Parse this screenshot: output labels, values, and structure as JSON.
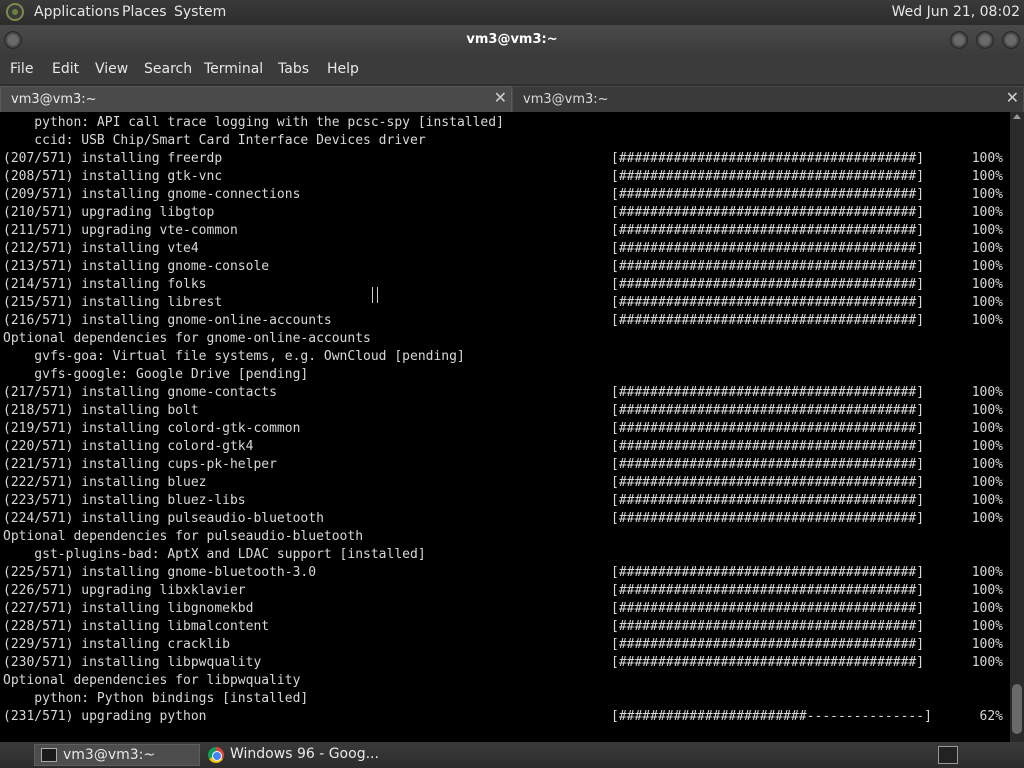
{
  "top_panel": {
    "menus": [
      "Applications",
      "Places",
      "System"
    ],
    "clock": "Wed Jun 21, 08:02"
  },
  "window": {
    "title": "vm3@vm3:~"
  },
  "menubar": [
    "File",
    "Edit",
    "View",
    "Search",
    "Terminal",
    "Tabs",
    "Help"
  ],
  "tabs": [
    {
      "label": "vm3@vm3:~",
      "active": true
    },
    {
      "label": "vm3@vm3:~",
      "active": false
    }
  ],
  "terminal": {
    "lines": [
      {
        "text": "    python: API call trace logging with the pcsc-spy [installed]"
      },
      {
        "text": "    ccid: USB Chip/Smart Card Interface Devices driver"
      },
      {
        "text": "(207/571) installing freerdp",
        "bar": "[######################################]",
        "pct": "100%"
      },
      {
        "text": "(208/571) installing gtk-vnc",
        "bar": "[######################################]",
        "pct": "100%"
      },
      {
        "text": "(209/571) installing gnome-connections",
        "bar": "[######################################]",
        "pct": "100%"
      },
      {
        "text": "(210/571) upgrading libgtop",
        "bar": "[######################################]",
        "pct": "100%"
      },
      {
        "text": "(211/571) upgrading vte-common",
        "bar": "[######################################]",
        "pct": "100%"
      },
      {
        "text": "(212/571) installing vte4",
        "bar": "[######################################]",
        "pct": "100%"
      },
      {
        "text": "(213/571) installing gnome-console",
        "bar": "[######################################]",
        "pct": "100%"
      },
      {
        "text": "(214/571) installing folks",
        "bar": "[######################################]",
        "pct": "100%"
      },
      {
        "text": "(215/571) installing librest",
        "bar": "[######################################]",
        "pct": "100%"
      },
      {
        "text": "(216/571) installing gnome-online-accounts",
        "bar": "[######################################]",
        "pct": "100%"
      },
      {
        "text": "Optional dependencies for gnome-online-accounts"
      },
      {
        "text": "    gvfs-goa: Virtual file systems, e.g. OwnCloud [pending]"
      },
      {
        "text": "    gvfs-google: Google Drive [pending]"
      },
      {
        "text": "(217/571) installing gnome-contacts",
        "bar": "[######################################]",
        "pct": "100%"
      },
      {
        "text": "(218/571) installing bolt",
        "bar": "[######################################]",
        "pct": "100%"
      },
      {
        "text": "(219/571) installing colord-gtk-common",
        "bar": "[######################################]",
        "pct": "100%"
      },
      {
        "text": "(220/571) installing colord-gtk4",
        "bar": "[######################################]",
        "pct": "100%"
      },
      {
        "text": "(221/571) installing cups-pk-helper",
        "bar": "[######################################]",
        "pct": "100%"
      },
      {
        "text": "(222/571) installing bluez",
        "bar": "[######################################]",
        "pct": "100%"
      },
      {
        "text": "(223/571) installing bluez-libs",
        "bar": "[######################################]",
        "pct": "100%"
      },
      {
        "text": "(224/571) installing pulseaudio-bluetooth",
        "bar": "[######################################]",
        "pct": "100%"
      },
      {
        "text": "Optional dependencies for pulseaudio-bluetooth"
      },
      {
        "text": "    gst-plugins-bad: AptX and LDAC support [installed]"
      },
      {
        "text": "(225/571) installing gnome-bluetooth-3.0",
        "bar": "[######################################]",
        "pct": "100%"
      },
      {
        "text": "(226/571) upgrading libxklavier",
        "bar": "[######################################]",
        "pct": "100%"
      },
      {
        "text": "(227/571) installing libgnomekbd",
        "bar": "[######################################]",
        "pct": "100%"
      },
      {
        "text": "(228/571) installing libmalcontent",
        "bar": "[######################################]",
        "pct": "100%"
      },
      {
        "text": "(229/571) installing cracklib",
        "bar": "[######################################]",
        "pct": "100%"
      },
      {
        "text": "(230/571) installing libpwquality",
        "bar": "[######################################]",
        "pct": "100%"
      },
      {
        "text": "Optional dependencies for libpwquality"
      },
      {
        "text": "    python: Python bindings [installed]"
      },
      {
        "text": "(231/571) upgrading python",
        "bar": "[########################---------------]",
        "pct": " 62%"
      }
    ]
  },
  "taskbar": {
    "tasks": [
      {
        "label": "vm3@vm3:~",
        "icon": "terminal-icon",
        "active": true
      },
      {
        "label": "Windows 96 - Goog...",
        "icon": "chrome-icon",
        "active": false
      }
    ]
  }
}
